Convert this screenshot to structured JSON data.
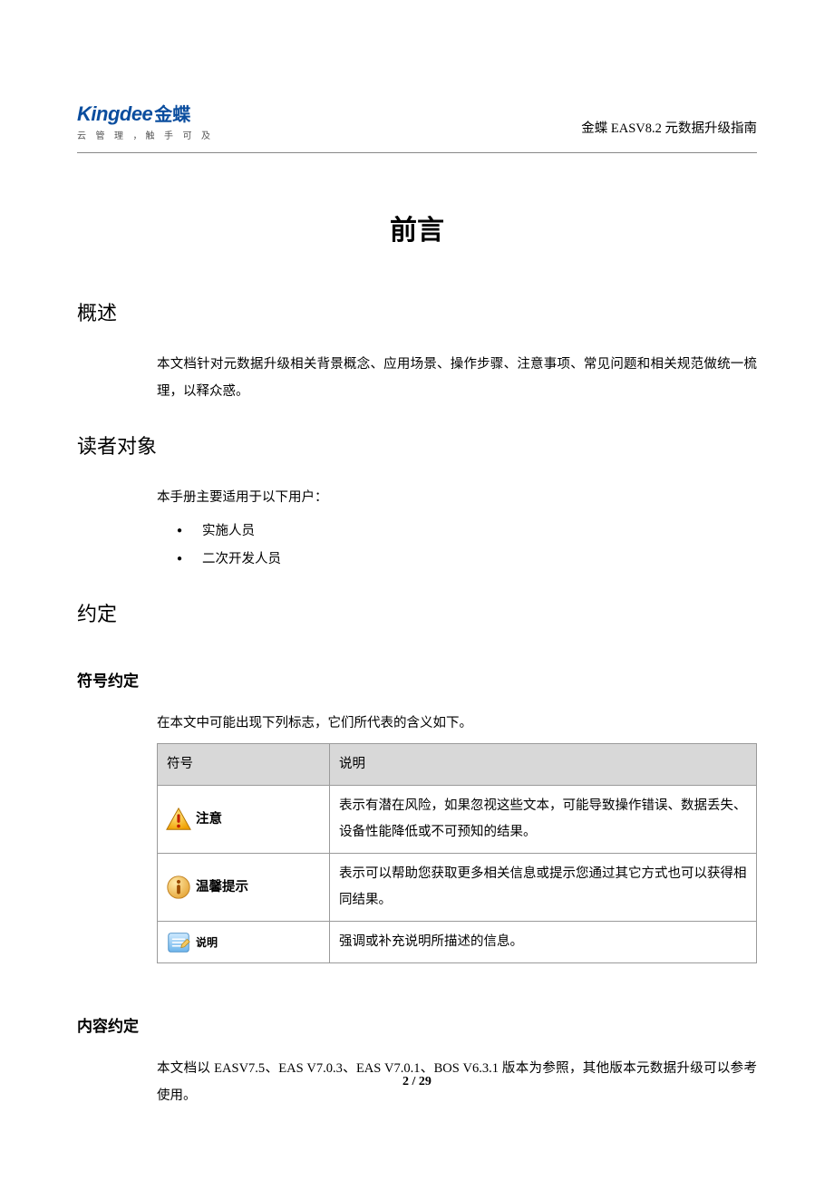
{
  "header": {
    "logo_en": "Kingdee",
    "logo_cn": "金蝶",
    "logo_tagline": "云 管 理 ，触 手 可 及",
    "doc_title": "金蝶 EASV8.2 元数据升级指南"
  },
  "title": "前言",
  "s1": {
    "heading": "概述",
    "para": "本文档针对元数据升级相关背景概念、应用场景、操作步骤、注意事项、常见问题和相关规范做统一梳理，以释众惑。"
  },
  "s2": {
    "heading": "读者对象",
    "intro": "本手册主要适用于以下用户：",
    "items": [
      "实施人员",
      "二次开发人员"
    ]
  },
  "s3": {
    "heading": "约定",
    "sub1": {
      "heading": "符号约定",
      "intro": "在本文中可能出现下列标志，它们所代表的含义如下。",
      "table": {
        "col1": "符号",
        "col2": "说明",
        "rows": [
          {
            "icon": "warning",
            "label": "注意",
            "desc": "表示有潜在风险，如果忽视这些文本，可能导致操作错误、数据丢失、设备性能降低或不可预知的结果。"
          },
          {
            "icon": "info",
            "label": "温馨提示",
            "desc": "表示可以帮助您获取更多相关信息或提示您通过其它方式也可以获得相同结果。"
          },
          {
            "icon": "note",
            "label": "说明",
            "desc": "强调或补充说明所描述的信息。"
          }
        ]
      }
    },
    "sub2": {
      "heading": "内容约定",
      "para": "本文档以 EASV7.5、EAS V7.0.3、EAS V7.0.1、BOS V6.3.1 版本为参照，其他版本元数据升级可以参考使用。"
    }
  },
  "footer": {
    "page": "2 / 29"
  }
}
